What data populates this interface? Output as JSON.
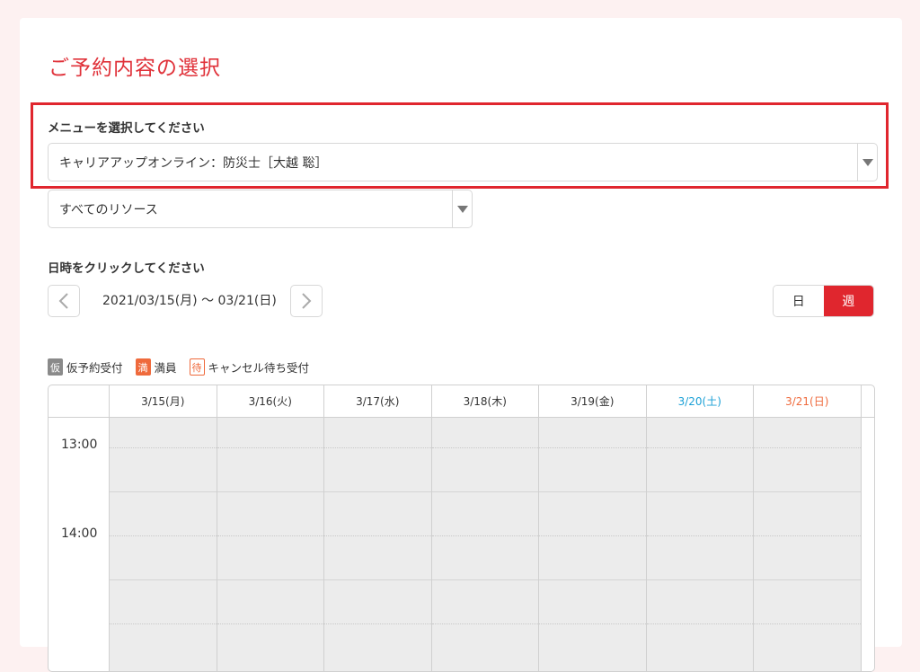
{
  "page": {
    "title": "ご予約内容の選択"
  },
  "menu": {
    "label": "メニューを選択してください",
    "selected": "キャリアアップオンライン：防災士［大越 聡］"
  },
  "resource": {
    "selected": "すべてのリソース"
  },
  "datetime": {
    "label": "日時をクリックしてください",
    "range": "2021/03/15(月) 〜 03/21(日)",
    "view_day": "日",
    "view_week": "週"
  },
  "legend": [
    {
      "badge": "仮",
      "text": "仮予約受付"
    },
    {
      "badge": "満",
      "text": "満員"
    },
    {
      "badge": "待",
      "text": "キャンセル待ち受付"
    }
  ],
  "calendar": {
    "days": [
      "3/15(月)",
      "3/16(火)",
      "3/17(水)",
      "3/18(木)",
      "3/19(金)",
      "3/20(土)",
      "3/21(日)"
    ],
    "times": [
      "13:00",
      "14:00"
    ]
  },
  "colors": {
    "accent": "#e0262e",
    "saturday": "#1ba0d6",
    "sunday": "#ef6a3c"
  },
  "icons": {
    "prev": "chevron-left-icon",
    "next": "chevron-right-icon",
    "dropdown": "caret-down-icon"
  }
}
